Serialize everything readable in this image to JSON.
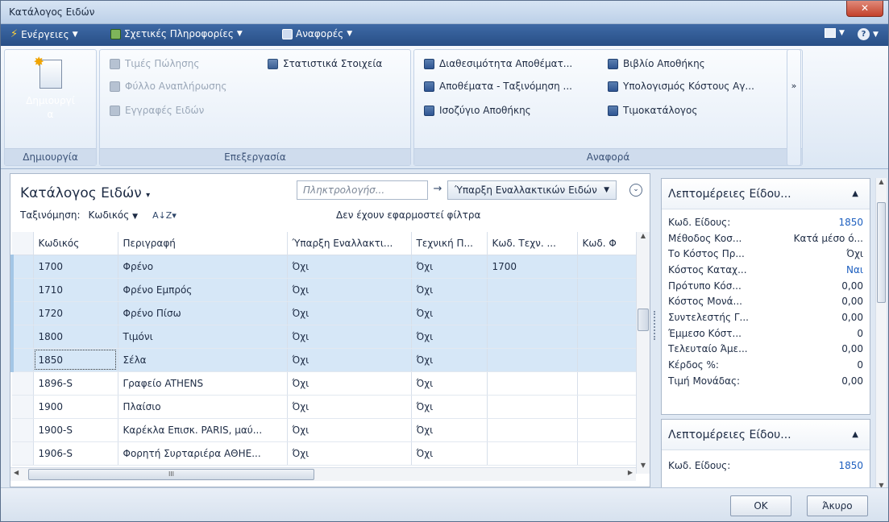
{
  "window": {
    "title": "Κατάλογος Ειδών"
  },
  "commandbar": {
    "actions": "Ενέργειες",
    "related": "Σχετικές Πληροφορίες",
    "reports": "Αναφορές"
  },
  "ribbon": {
    "groups": {
      "create": "Δημιουργία",
      "process": "Επεξεργασία",
      "report": "Αναφορά"
    },
    "new_line1": "Δημιουργί",
    "new_line2": "α",
    "process_items": [
      "Τιμές Πώλησης",
      "Φύλλο Αναπλήρωσης",
      "Εγγραφές Ειδών"
    ],
    "stats": "Στατιστικά Στοιχεία",
    "report_items": [
      "Διαθεσιμότητα Αποθέματ...",
      "Αποθέματα - Ταξινόμηση ...",
      "Ισοζύγιο Αποθήκης",
      "Βιβλίο Αποθήκης",
      "Υπολογισμός Κόστους Αγ...",
      "Τιμοκατάλογος"
    ],
    "more": "»"
  },
  "list": {
    "title": "Κατάλογος Ειδών",
    "filter_placeholder": "Πληκτρολογήσ...",
    "filter_field": "Ύπαρξη Εναλλακτικών Ειδών",
    "sort_label": "Ταξινόμηση:",
    "sort_field": "Κωδικός",
    "no_filter": "Δεν έχουν εφαρμοστεί φίλτρα",
    "columns": [
      "Κωδικός",
      "Περιγραφή",
      "Ύπαρξη Εναλλακτι...",
      "Τεχνική Π...",
      "Κωδ. Τεχν. ...",
      "Κωδ. Φ"
    ],
    "rows": [
      {
        "code": "1700",
        "desc": "Φρένο",
        "alt": "Όχι",
        "tech": "Όχι",
        "techcode": "1700",
        "sel": true
      },
      {
        "code": "1710",
        "desc": "Φρένο Εμπρός",
        "alt": "Όχι",
        "tech": "Όχι",
        "techcode": "",
        "sel": true
      },
      {
        "code": "1720",
        "desc": "Φρένο Πίσω",
        "alt": "Όχι",
        "tech": "Όχι",
        "techcode": "",
        "sel": true
      },
      {
        "code": "1800",
        "desc": "Τιμόνι",
        "alt": "Όχι",
        "tech": "Όχι",
        "techcode": "",
        "sel": true
      },
      {
        "code": "1850",
        "desc": "Σέλα",
        "alt": "Όχι",
        "tech": "Όχι",
        "techcode": "",
        "sel": true
      },
      {
        "code": "1896-S",
        "desc": "Γραφείο ATHENS",
        "alt": "Όχι",
        "tech": "Όχι",
        "techcode": "",
        "sel": false
      },
      {
        "code": "1900",
        "desc": "Πλαίσιο",
        "alt": "Όχι",
        "tech": "Όχι",
        "techcode": "",
        "sel": false
      },
      {
        "code": "1900-S",
        "desc": "Καρέκλα Επισκ. PARIS, μαύ...",
        "alt": "Όχι",
        "tech": "Όχι",
        "techcode": "",
        "sel": false
      },
      {
        "code": "1906-S",
        "desc": "Φορητή Συρταριέρα ΑΘΗΕ...",
        "alt": "Όχι",
        "tech": "Όχι",
        "techcode": "",
        "sel": false
      }
    ]
  },
  "factbox": {
    "title1": "Λεπτομέρειες Είδου...",
    "fields": [
      {
        "label": "Κωδ. Είδους:",
        "value": "1850",
        "link": true
      },
      {
        "label": "Μέθοδος Κοσ...",
        "value": "Κατά μέσο ό...",
        "link": false
      },
      {
        "label": "Το Κόστος Πρ...",
        "value": "Όχι",
        "link": false
      },
      {
        "label": "Κόστος Καταχ...",
        "value": "Ναι",
        "link": true
      },
      {
        "label": "Πρότυπο Κόσ...",
        "value": "0,00",
        "link": false
      },
      {
        "label": "Κόστος Μονά...",
        "value": "0,00",
        "link": false
      },
      {
        "label": "Συντελεστής Γ...",
        "value": "0,00",
        "link": false
      },
      {
        "label": "Έμμεσο Κόστ...",
        "value": "0",
        "link": false
      },
      {
        "label": "Τελευταίο Άμε...",
        "value": "0,00",
        "link": false
      },
      {
        "label": "Κέρδος %:",
        "value": "0",
        "link": false
      },
      {
        "label": "Τιμή Μονάδας:",
        "value": "0,00",
        "link": false
      }
    ],
    "title2": "Λεπτομέρειες Είδου...",
    "field2": {
      "label": "Κωδ. Είδους:",
      "value": "1850"
    }
  },
  "buttons": {
    "ok": "OK",
    "cancel": "Άκυρο"
  },
  "colors": {
    "commandbar": "#2f5a93",
    "selected_row": "#d6e7f7",
    "link": "#1d5fbf"
  }
}
